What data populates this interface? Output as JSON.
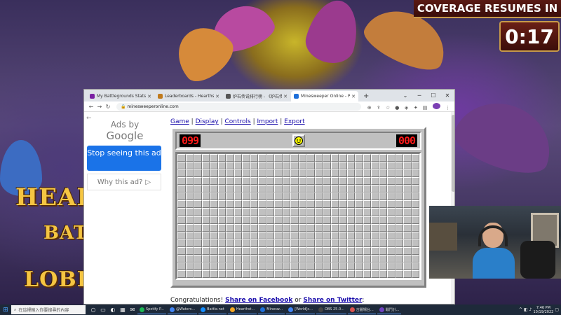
{
  "overlay": {
    "coverage_text": "COVERAGE RESUMES IN",
    "timer": "0:17",
    "logo_line1": "HEAR",
    "logo_line2": "BATT",
    "logo_line3": "LOBB"
  },
  "browser": {
    "tabs": [
      {
        "label": "My Battlegrounds Stats - HSR",
        "color": "#7a1fa2",
        "active": false
      },
      {
        "label": "Leaderboards - Hearthstone",
        "color": "#c07a1c",
        "active": false
      },
      {
        "label": "炉石传说排行榜 - 《炉石传说》",
        "color": "#555555",
        "active": false
      },
      {
        "label": "Minesweeper Online - Play fre",
        "color": "#1e6fd9",
        "active": true
      }
    ],
    "url": "minesweeperonline.com",
    "new_tab": "+"
  },
  "ad": {
    "ads_by": "Ads by",
    "google": "Google",
    "stop_label": "Stop seeing this ad",
    "why_label": "Why this ad?"
  },
  "game": {
    "menu": [
      "Game",
      "Display",
      "Controls",
      "Import",
      "Export"
    ],
    "mine_counter": "099",
    "time_counter": "000",
    "rows": 16,
    "cols": 30
  },
  "congrats": {
    "text": "Congratulations!",
    "facebook": "Share on Facebook",
    "or": "or",
    "twitter": "Share on Twitter",
    "colon": ":"
  },
  "taskbar": {
    "search_placeholder": "在這裡輸入你要搜尋的內容",
    "apps": [
      {
        "label": "Spotify P...",
        "color": "#1db954"
      },
      {
        "label": "@Waters...",
        "color": "#4285f4"
      },
      {
        "label": "Battle.net",
        "color": "#148eff"
      },
      {
        "label": "Hearthst...",
        "color": "#f5a623"
      },
      {
        "label": "Minesw...",
        "color": "#1e6fd9"
      },
      {
        "label": "[World]c...",
        "color": "#4285f4"
      },
      {
        "label": "OBS 25.0...",
        "color": "#444444"
      },
      {
        "label": "古麗場台...",
        "color": "#d9534f"
      },
      {
        "label": "戰鬥計...",
        "color": "#6f42c1"
      }
    ],
    "time": "7:46 PM",
    "date": "10/19/2022"
  }
}
